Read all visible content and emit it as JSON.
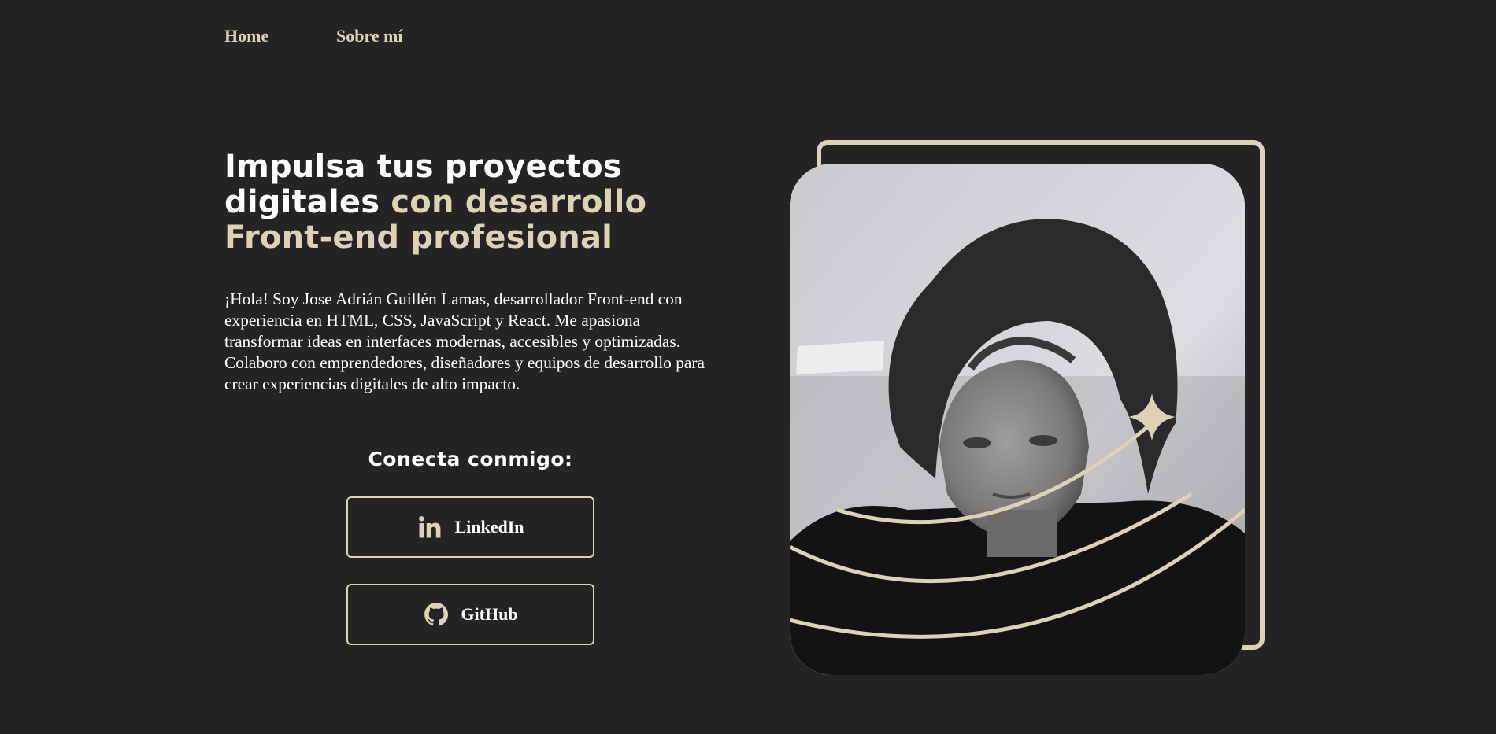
{
  "nav": {
    "home_label": "Home",
    "about_label": "Sobre mí"
  },
  "hero": {
    "title_white": "Impulsa tus proyectos digitales ",
    "title_accent": "con desarrollo Front-end profesional",
    "bio": "¡Hola! Soy Jose Adrián Guillén Lamas, desarrollador Front-end con experiencia en HTML, CSS, JavaScript y React. Me apasiona transformar ideas en interfaces modernas, accesibles y optimizadas. Colaboro con emprendedores, diseñadores y equipos de desarrollo para crear experiencias digitales de alto impacto."
  },
  "connect": {
    "heading": "Conecta conmigo:",
    "linkedin": {
      "label": "LinkedIn",
      "icon": "linkedin-icon"
    },
    "github": {
      "label": "GitHub",
      "icon": "github-icon"
    }
  },
  "portrait": {
    "decoration_icon": "sparkle-star-icon"
  },
  "colors": {
    "background": "#242424",
    "accent": "#ddd1b6",
    "text": "#ffffff"
  }
}
